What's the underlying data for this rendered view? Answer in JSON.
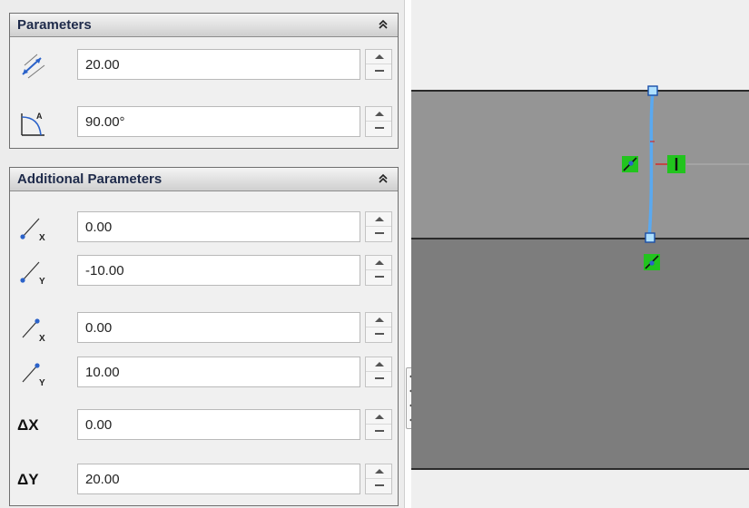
{
  "parameters": {
    "title": "Parameters",
    "length": {
      "value": "20.00"
    },
    "angle": {
      "value": "90.00°"
    }
  },
  "additional": {
    "title": "Additional Parameters",
    "start_x": {
      "value": "0.00"
    },
    "start_y": {
      "value": "-10.00"
    },
    "end_x": {
      "value": "0.00"
    },
    "end_y": {
      "value": "10.00"
    },
    "delta_x": {
      "label": "ΔX",
      "value": "0.00"
    },
    "delta_y": {
      "label": "ΔY",
      "value": "20.00"
    }
  },
  "icons": {
    "length": "length-dimension-icon",
    "angle": "angle-icon",
    "start_x": "start-point-x-icon",
    "start_y": "start-point-y-icon",
    "end_x": "end-point-x-icon",
    "end_y": "end-point-y-icon",
    "collapse": "double-chevron-up-icon"
  },
  "colors": {
    "sketch_line": "#5aa9f0",
    "constraint_green": "#22c41e",
    "accent_blue": "#2b62c9",
    "relation_red": "#d22a2a"
  }
}
